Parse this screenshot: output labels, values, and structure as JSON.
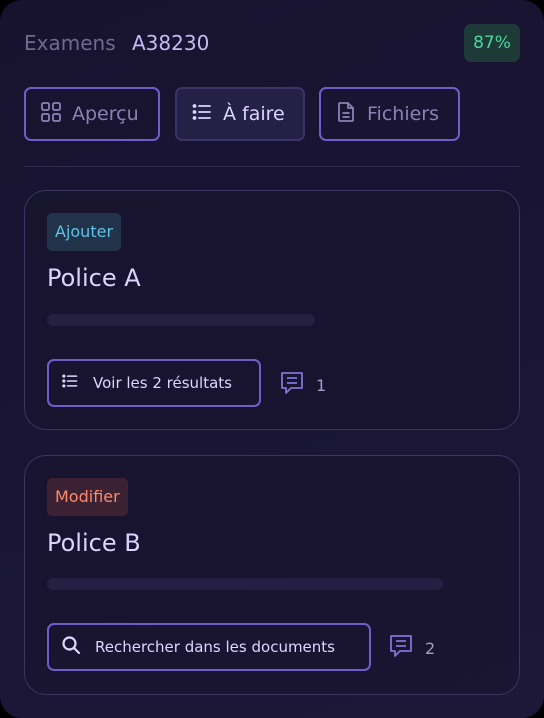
{
  "header": {
    "label": "Examens",
    "id": "A38230",
    "percent": "87%"
  },
  "tabs": [
    {
      "label": "Aperçu",
      "icon": "grid-icon",
      "active": false
    },
    {
      "label": "À faire",
      "icon": "list-icon",
      "active": true
    },
    {
      "label": "Fichiers",
      "icon": "document-icon",
      "active": false
    }
  ],
  "cards": [
    {
      "tag": "Ajouter",
      "title": "Police A",
      "action_label": "Voir les 2 résultats",
      "action_icon": "list-icon",
      "comment_count": "1",
      "comment_icon": "comment-icon"
    },
    {
      "tag": "Modifier",
      "title": "Police B",
      "action_label": "Rechercher dans les documents",
      "action_icon": "search-icon",
      "comment_count": "2",
      "comment_icon": "comment-icon"
    }
  ],
  "colors": {
    "accent_border": "#6d5fc9",
    "success": "#4bd89a",
    "tag_add": "#5fc2e8",
    "tag_modify": "#ff8a6b"
  }
}
